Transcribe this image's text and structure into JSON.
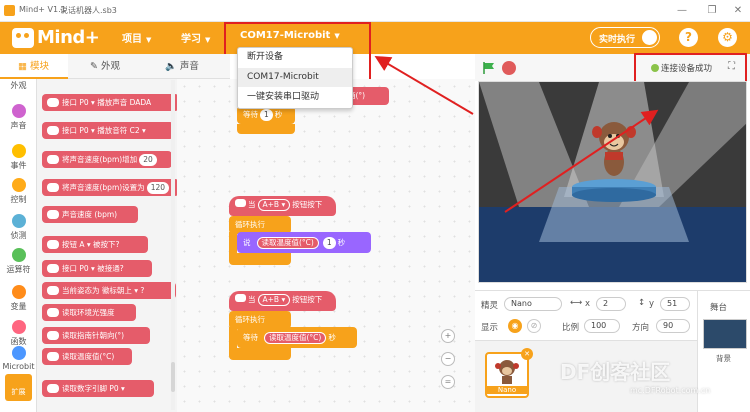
{
  "titlebar": {
    "app_name": "Mind+ V1.1",
    "file_name": "说话机器人.sb3",
    "minimize": "—",
    "maximize": "❐",
    "close": "✕"
  },
  "menubar": {
    "logo": "Mind+",
    "project": "项目",
    "learn": "学习",
    "port": "COM17-Microbit",
    "realtime": "实时执行",
    "help_icon": "?",
    "settings_icon": "⚙"
  },
  "port_dropdown": {
    "options": [
      "断开设备",
      "COM17-Microbit",
      "一键安装串口驱动"
    ],
    "selected_index": 1
  },
  "tabs": {
    "blocks": "模块",
    "costumes": "外观",
    "sounds": "声音"
  },
  "categories": [
    {
      "label": "外观",
      "color": "#9966ff"
    },
    {
      "label": "声音",
      "color": "#cf63cf"
    },
    {
      "label": "事件",
      "color": "#ffbf00"
    },
    {
      "label": "控制",
      "color": "#ffab19"
    },
    {
      "label": "侦测",
      "color": "#5cb1d6"
    },
    {
      "label": "运算符",
      "color": "#59c059"
    },
    {
      "label": "变量",
      "color": "#ff8c1a"
    },
    {
      "label": "函数",
      "color": "#ff6680"
    },
    {
      "label": "Microbit",
      "color": "#4c97ff"
    }
  ],
  "extensions_label": "扩展",
  "palette_blocks": [
    {
      "text": "接口 P0 ▾ 播放声音 DADA"
    },
    {
      "text": "接口 P0 ▾ 播放音符 C2 ▾"
    },
    {
      "text": "将声音速度(bpm)增加",
      "pill": "20"
    },
    {
      "text": "将声音速度(bpm)设置为",
      "pill": "120"
    },
    {
      "text": "声音速度 (bpm)"
    },
    {
      "text": "按钮 A ▾ 被按下?"
    },
    {
      "text": "接口 P0 ▾ 被接通?"
    },
    {
      "text": "当前姿态为 徽标朝上 ▾ ?"
    },
    {
      "text": "读取环境光强度"
    },
    {
      "text": "读取指南针朝向(°)"
    },
    {
      "text": "读取温度值(°C)"
    },
    {
      "text": "读取数字引脚 P0 ▾"
    }
  ],
  "script": {
    "top_wait": "等待",
    "top_wait_value": "1",
    "top_wait_unit": "秒",
    "top_partial": "箱(°)",
    "when": "当",
    "button_ab": "A+B ▾",
    "pressed": "按钮按下",
    "forever": "循环执行",
    "say": "说",
    "read_temp": "读取温度值(°C)",
    "say_value": "1",
    "seconds": "秒",
    "wait": "等待"
  },
  "stage_header": {
    "connection_status": "连接设备成功",
    "fullscreen_icon": "⛶"
  },
  "sprite_info": {
    "sprite_label": "精灵",
    "sprite_name": "Nano",
    "x_label": "x",
    "x_value": "2",
    "y_label": "y",
    "y_value": "51",
    "show_label": "显示",
    "size_label": "比例",
    "size_value": "100",
    "direction_label": "方向",
    "direction_value": "90"
  },
  "sprite_list": [
    {
      "name": "Nano"
    }
  ],
  "stage_panel": {
    "label": "舞台",
    "backdrop_label": "背景"
  },
  "watermark": {
    "main": "DF创客社区",
    "sub": "mc.DFRobot.com.cn"
  },
  "colors": {
    "brand": "#f7a21b",
    "highlight": "#e02020",
    "block_red": "#e55c6a",
    "block_purple": "#9966ff",
    "connected": "#8bc34a"
  }
}
